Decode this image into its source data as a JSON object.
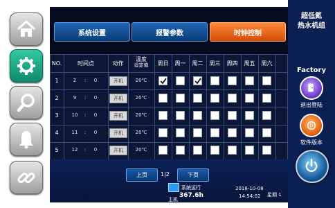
{
  "nav": {
    "items": [
      {
        "icon": "home-icon"
      },
      {
        "icon": "gear-icon",
        "active": true
      },
      {
        "icon": "search-icon"
      },
      {
        "icon": "bell-icon"
      },
      {
        "icon": "link-icon"
      }
    ]
  },
  "tabs": {
    "system": "系统设置",
    "alarm": "报警参数",
    "clock": "时钟控制",
    "active": "clock"
  },
  "table": {
    "headers": {
      "no": "NO.",
      "time": "时间点",
      "action": "动作",
      "temp_line1": "温度",
      "temp_line2": "设定值",
      "days": [
        "周日",
        "周一",
        "周二",
        "周三",
        "周四",
        "周五",
        "周六"
      ]
    },
    "rows": [
      {
        "no": "1",
        "hour": "2",
        "sep": ":",
        "minute": "0",
        "action": "开机",
        "temp": "20℃",
        "days": [
          true,
          false,
          true,
          false,
          false,
          false,
          false
        ]
      },
      {
        "no": "2",
        "hour": "9",
        "sep": ":",
        "minute": "0",
        "action": "开机",
        "temp": "20℃",
        "days": [
          false,
          false,
          false,
          false,
          false,
          false,
          false
        ]
      },
      {
        "no": "3",
        "hour": "10",
        "sep": ":",
        "minute": "0",
        "action": "开机",
        "temp": "20℃",
        "days": [
          false,
          false,
          false,
          false,
          false,
          false,
          false
        ]
      },
      {
        "no": "4",
        "hour": "11",
        "sep": ":",
        "minute": "0",
        "action": "开机",
        "temp": "20℃",
        "days": [
          false,
          false,
          false,
          false,
          false,
          false,
          false
        ]
      },
      {
        "no": "5",
        "hour": "12",
        "sep": ":",
        "minute": "0",
        "action": "开机",
        "temp": "20℃",
        "days": [
          false,
          false,
          false,
          false,
          false,
          false,
          false
        ]
      }
    ]
  },
  "pager": {
    "prev": "上页",
    "current": "1",
    "separator": "|",
    "total": "2",
    "next": "下页"
  },
  "status": {
    "runtime_label": "系统运行",
    "runtime_value": "367.6h",
    "host_label": "主机",
    "date": "2018-10-08",
    "time": "14:54:02",
    "weekday_label": "星期",
    "weekday_value": "1"
  },
  "right": {
    "title_line1": "超低氮",
    "title_line2": "热水机组",
    "brand": "Factory",
    "logout_label": "退出登陆",
    "version_label": "软件版本"
  },
  "colors": {
    "accent": "#e8641c",
    "panel": "#050b1e",
    "tab": "#1458a3",
    "nav_active": "#1fa386"
  }
}
